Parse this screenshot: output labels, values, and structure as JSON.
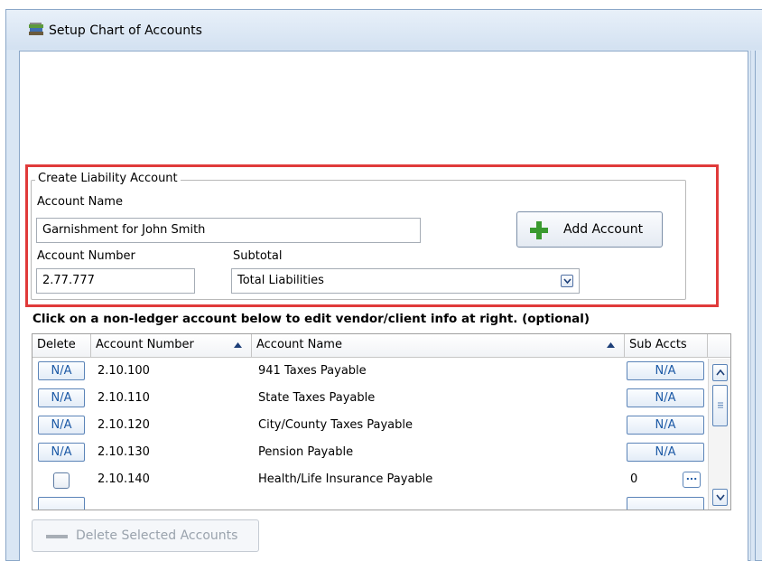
{
  "window": {
    "title": "Setup Chart of Accounts"
  },
  "form": {
    "group_title": "Create Liability Account",
    "account_name_label": "Account Name",
    "account_name_value": "Garnishment for John Smith",
    "account_number_label": "Account Number",
    "account_number_value": "2.77.777",
    "subtotal_label": "Subtotal",
    "subtotal_value": "Total Liabilities",
    "add_button_label": "Add Account"
  },
  "instruction": "Click on a non-ledger account below to edit vendor/client info at right. (optional)",
  "table": {
    "columns": [
      "Delete",
      "Account Number",
      "Account Name",
      "Sub Accts"
    ],
    "rows": [
      {
        "delete": "N/A",
        "number": "2.10.100",
        "name": "941 Taxes Payable",
        "sub": "N/A"
      },
      {
        "delete": "N/A",
        "number": "2.10.110",
        "name": "State Taxes Payable",
        "sub": "N/A"
      },
      {
        "delete": "N/A",
        "number": "2.10.120",
        "name": "City/County Taxes Payable",
        "sub": "N/A"
      },
      {
        "delete": "N/A",
        "number": "2.10.130",
        "name": "Pension Payable",
        "sub": "N/A"
      },
      {
        "delete": "",
        "number": "2.10.140",
        "name": "Health/Life Insurance Payable",
        "sub": "0"
      }
    ]
  },
  "delete_button_label": "Delete Selected Accounts",
  "icons": {
    "title": "books-icon",
    "add": "plus-icon",
    "delete": "minus-icon"
  },
  "colors": {
    "highlight": "#e03a3a",
    "accent": "#1d5aa6",
    "plus_green": "#3a9a2f"
  }
}
